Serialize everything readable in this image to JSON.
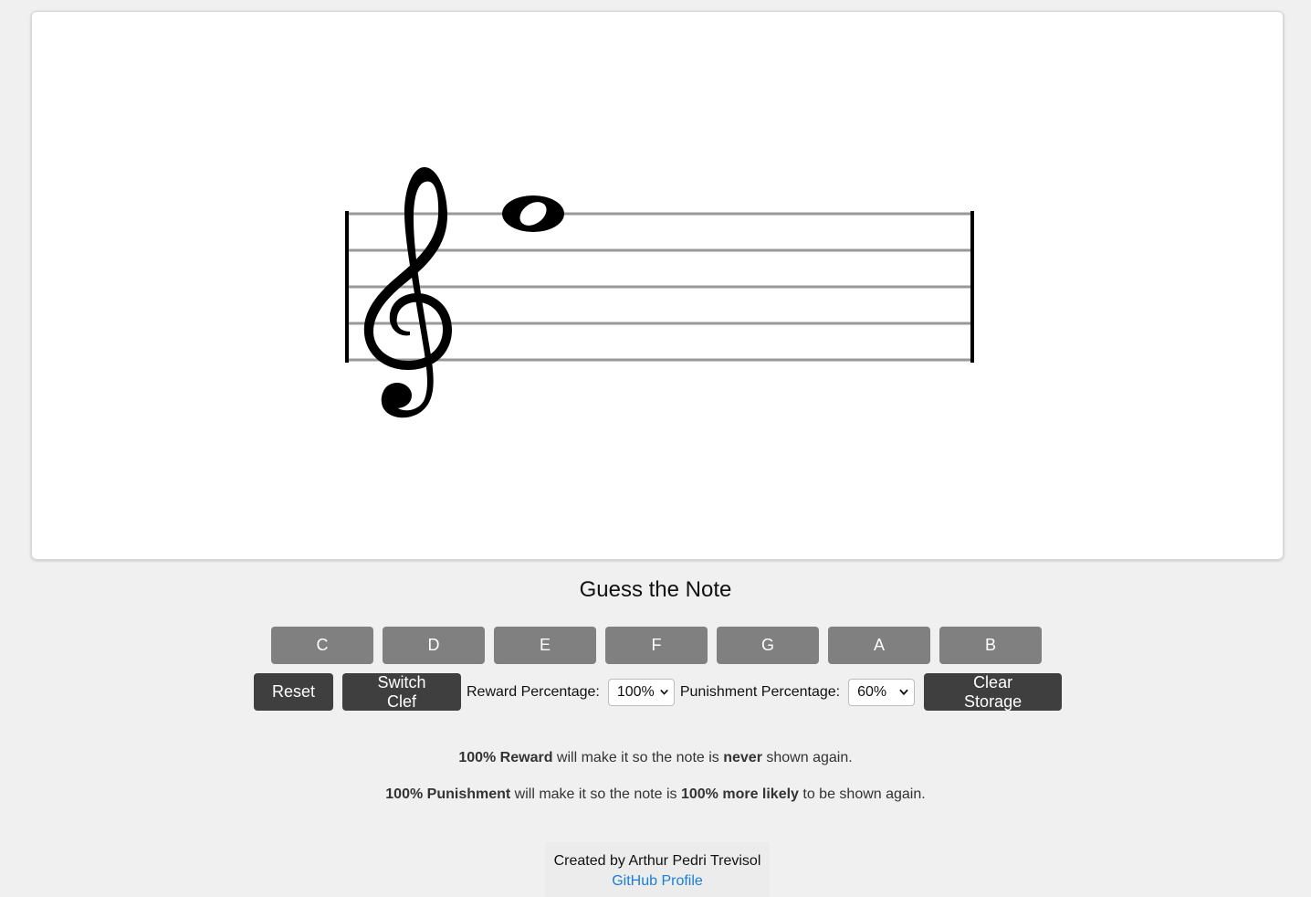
{
  "staff": {
    "clef": "treble",
    "note": "F5"
  },
  "heading": "Guess the Note",
  "note_buttons": [
    "C",
    "D",
    "E",
    "F",
    "G",
    "A",
    "B"
  ],
  "controls": {
    "reset_label": "Reset",
    "switch_clef_label": "Switch Clef",
    "reward_label": "Reward Percentage:",
    "reward_value": "100%",
    "punishment_label": "Punishment Percentage:",
    "punishment_value": "60%",
    "clear_storage_label": "Clear Storage"
  },
  "info": {
    "reward": {
      "bold1": "100% Reward",
      "text1": " will make it so the note is ",
      "bold2": "never",
      "text2": " shown again."
    },
    "punishment": {
      "bold1": "100% Punishment",
      "text1": " will make it so the note is ",
      "bold2": "100% more likely",
      "text2": " to be shown again."
    }
  },
  "footer": {
    "credit": "Created by Arthur Pedri Trevisol",
    "link_text": "GitHub Profile"
  }
}
